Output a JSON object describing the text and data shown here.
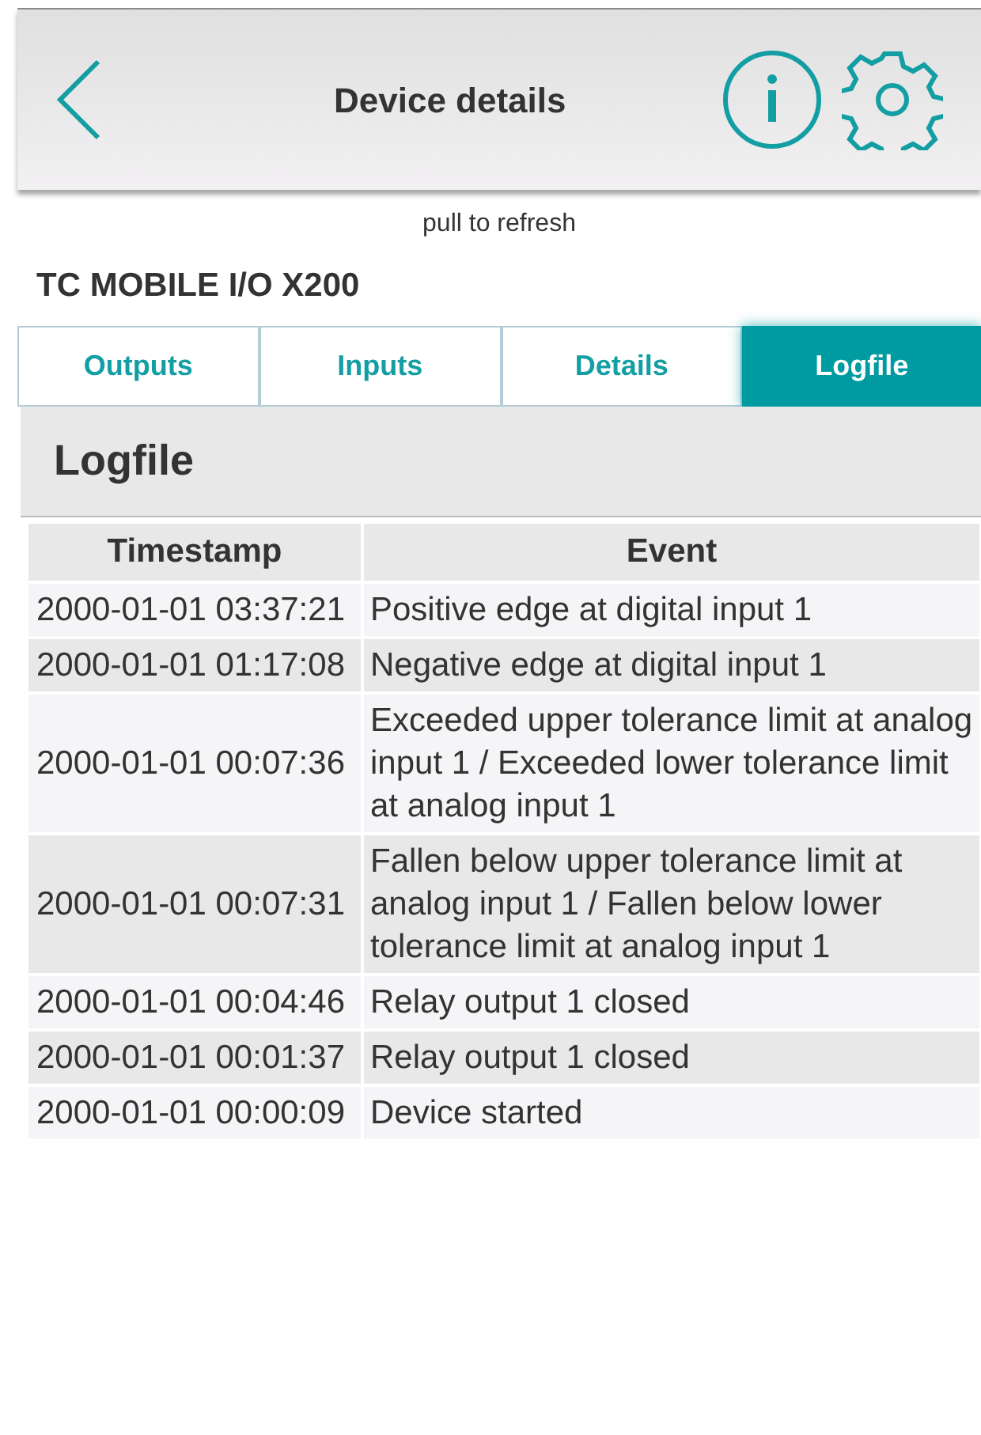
{
  "header": {
    "title": "Device details"
  },
  "pull_hint": "pull to refresh",
  "device_name": "TC MOBILE I/O X200",
  "tabs": [
    {
      "label": "Outputs",
      "selected": false
    },
    {
      "label": "Inputs",
      "selected": false
    },
    {
      "label": "Details",
      "selected": false
    },
    {
      "label": "Logfile",
      "selected": true
    }
  ],
  "section_title": "Logfile",
  "table": {
    "columns": [
      "Timestamp",
      "Event"
    ],
    "rows": [
      {
        "timestamp": "2000-01-01 03:37:21",
        "event": "Positive edge at digital input 1"
      },
      {
        "timestamp": "2000-01-01 01:17:08",
        "event": "Negative edge at digital input 1"
      },
      {
        "timestamp": "2000-01-01 00:07:36",
        "event": "Exceeded upper tolerance limit at analog input 1 / Exceeded lower tolerance limit at analog input 1"
      },
      {
        "timestamp": "2000-01-01 00:07:31",
        "event": "Fallen below upper tolerance limit at analog input 1 / Fallen below lower tolerance limit at analog input 1"
      },
      {
        "timestamp": "2000-01-01 00:04:46",
        "event": "Relay output 1 closed"
      },
      {
        "timestamp": "2000-01-01 00:01:37",
        "event": "Relay output 1 closed"
      },
      {
        "timestamp": "2000-01-01 00:00:09",
        "event": "Device started"
      }
    ]
  }
}
